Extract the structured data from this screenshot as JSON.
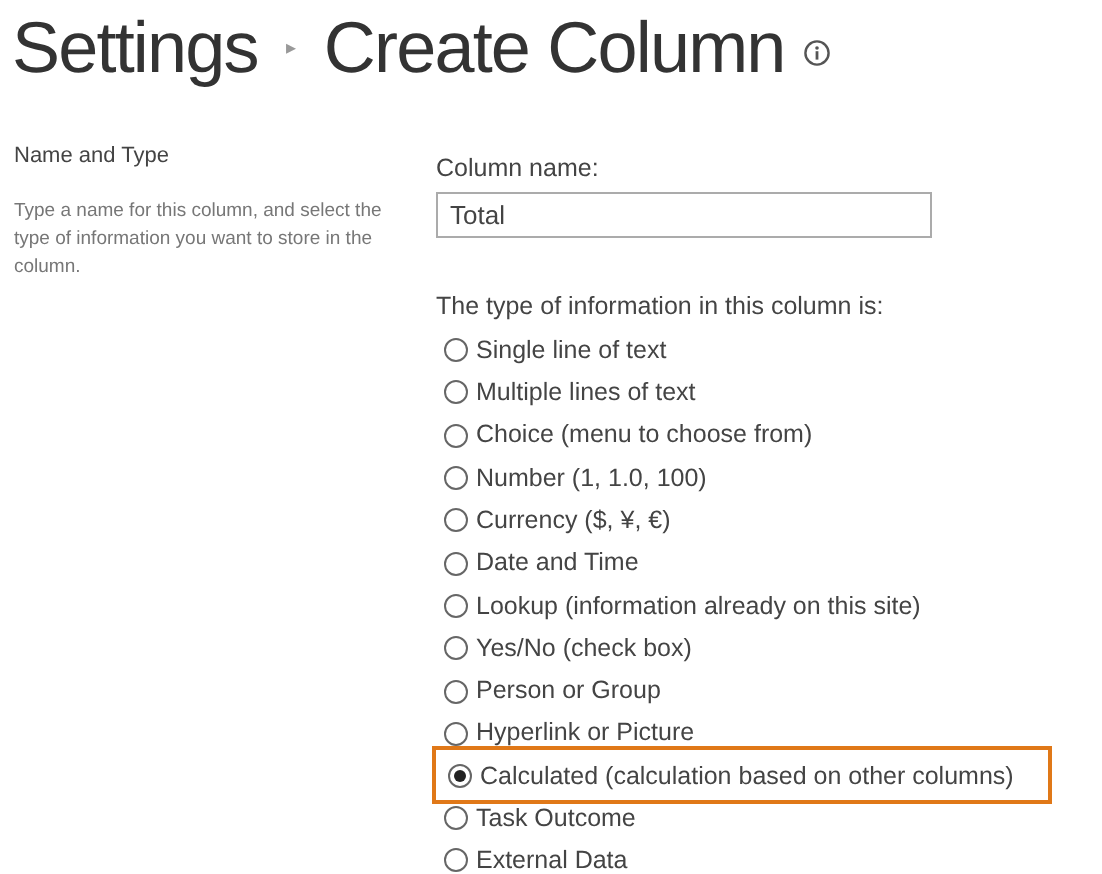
{
  "breadcrumb": {
    "parent": "Settings",
    "separator": "▸",
    "title": "Create Column"
  },
  "section": {
    "heading": "Name and Type",
    "description": "Type a name for this column, and select the type of information you want to store in the column."
  },
  "column_name": {
    "label": "Column name:",
    "value": "Total"
  },
  "type_prompt": "The type of information in this column is:",
  "types": [
    {
      "label": "Single line of text",
      "selected": false,
      "highlighted": false
    },
    {
      "label": "Multiple lines of text",
      "selected": false,
      "highlighted": false
    },
    {
      "label": "Choice (menu to choose from)",
      "selected": false,
      "highlighted": false
    },
    {
      "label": "Number (1, 1.0, 100)",
      "selected": false,
      "highlighted": false
    },
    {
      "label": "Currency ($, ¥, €)",
      "selected": false,
      "highlighted": false
    },
    {
      "label": "Date and Time",
      "selected": false,
      "highlighted": false
    },
    {
      "label": "Lookup (information already on this site)",
      "selected": false,
      "highlighted": false
    },
    {
      "label": "Yes/No (check box)",
      "selected": false,
      "highlighted": false
    },
    {
      "label": "Person or Group",
      "selected": false,
      "highlighted": false
    },
    {
      "label": "Hyperlink or Picture",
      "selected": false,
      "highlighted": false
    },
    {
      "label": "Calculated (calculation based on other columns)",
      "selected": true,
      "highlighted": true
    },
    {
      "label": "Task Outcome",
      "selected": false,
      "highlighted": false
    },
    {
      "label": "External Data",
      "selected": false,
      "highlighted": false
    }
  ]
}
